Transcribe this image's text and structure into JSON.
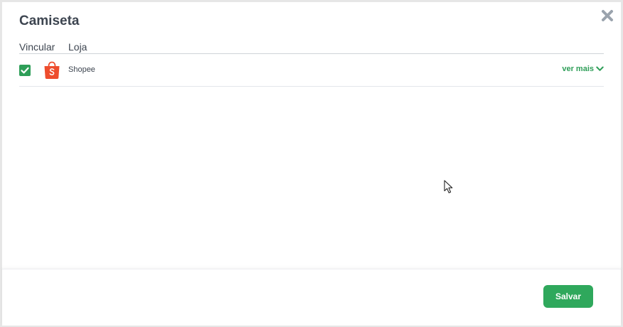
{
  "modal": {
    "title": "Camiseta"
  },
  "table": {
    "headers": {
      "vincular": "Vincular",
      "loja": "Loja"
    },
    "rows": [
      {
        "checked": true,
        "store_name": "Shopee",
        "logo_icon": "shopee-bag-icon",
        "expand_label": "ver mais"
      }
    ]
  },
  "footer": {
    "save_label": "Salvar"
  },
  "colors": {
    "accent": "#2e9e58",
    "title_text": "#3d4550",
    "shopee_orange": "#ee4d2d",
    "close_icon": "#9aa3ad"
  }
}
